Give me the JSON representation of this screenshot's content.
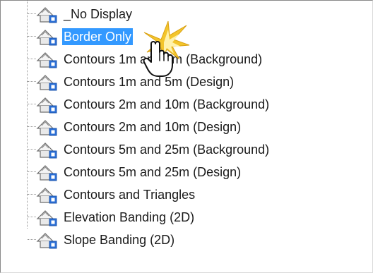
{
  "tree": {
    "items": [
      {
        "label": "_No Display",
        "selected": false
      },
      {
        "label": "Border Only",
        "selected": true
      },
      {
        "label": "Contours 1m and 5m (Background)",
        "selected": false
      },
      {
        "label": "Contours 1m and 5m (Design)",
        "selected": false
      },
      {
        "label": "Contours 2m and 10m (Background)",
        "selected": false
      },
      {
        "label": "Contours 2m and 10m (Design)",
        "selected": false
      },
      {
        "label": "Contours 5m and 25m (Background)",
        "selected": false
      },
      {
        "label": "Contours 5m and 25m (Design)",
        "selected": false
      },
      {
        "label": "Contours and Triangles",
        "selected": false
      },
      {
        "label": "Elevation Banding (2D)",
        "selected": false
      },
      {
        "label": "Slope Banding (2D)",
        "selected": false
      }
    ],
    "item_icon": "surface-style-icon",
    "cursor_icon": "hand-pointer-click-icon"
  },
  "colors": {
    "selection": "#3399ff",
    "icon_accent": "#2b6fd6",
    "click_burst": "#f2c11b"
  }
}
